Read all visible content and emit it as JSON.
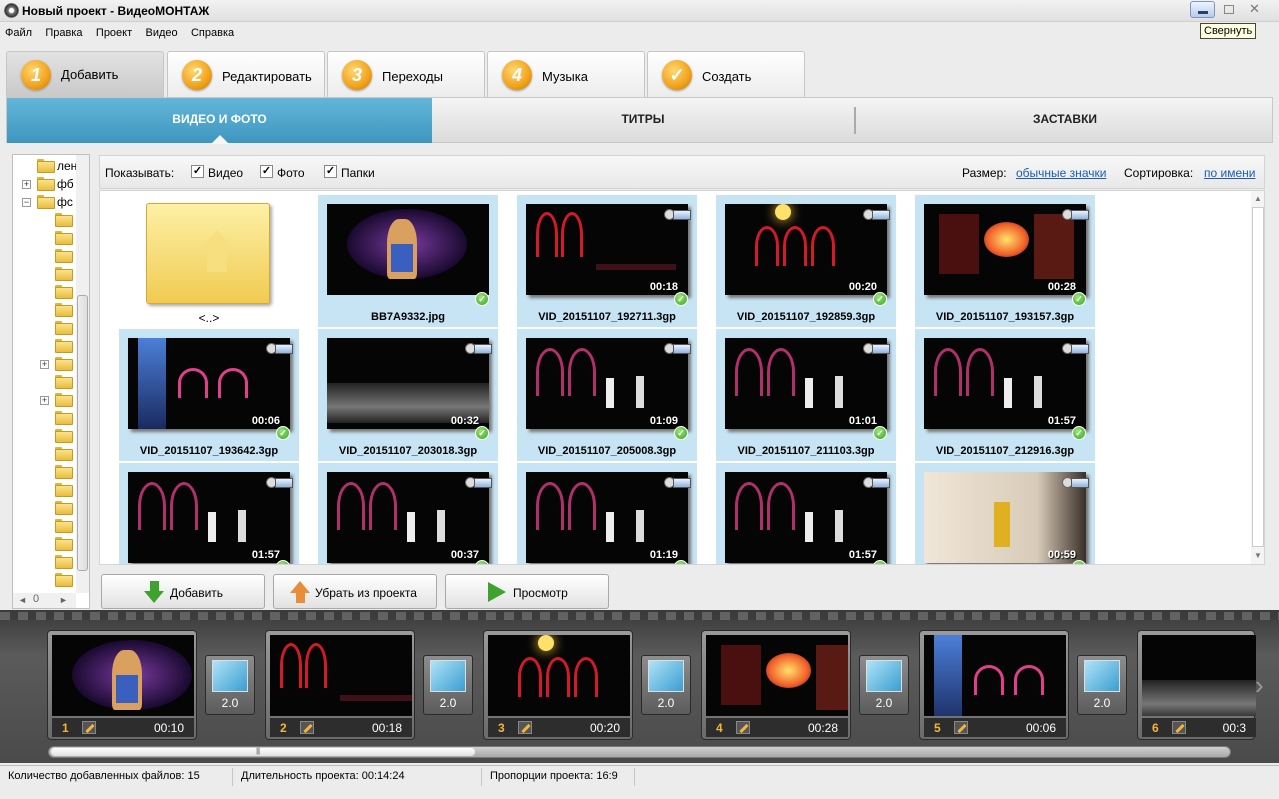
{
  "window": {
    "title": "Новый проект - ВидеоМОНТАЖ",
    "tooltip": "Свернуть",
    "close_glyph": "✕"
  },
  "menu": [
    "Файл",
    "Правка",
    "Проект",
    "Видео",
    "Справка"
  ],
  "steps": [
    {
      "num": "1",
      "label": "Добавить",
      "active": true
    },
    {
      "num": "2",
      "label": "Редактировать"
    },
    {
      "num": "3",
      "label": "Переходы"
    },
    {
      "num": "4",
      "label": "Музыка"
    },
    {
      "num": "✓",
      "label": "Создать"
    }
  ],
  "subtabs": {
    "video": "ВИДЕО И ФОТО",
    "titles": "ТИТРЫ",
    "screens": "ЗАСТАВКИ"
  },
  "tree": {
    "labels": [
      "лен",
      "фб",
      "фс"
    ],
    "expanders": [
      "+",
      "−",
      "+",
      "+"
    ],
    "hscroll_value": "0"
  },
  "filter": {
    "show_label": "Показывать:",
    "video": "Видео",
    "photo": "Фото",
    "folders": "Папки",
    "check": "✓",
    "size_label": "Размер:",
    "size_value": "обычные значки",
    "sort_label": "Сортировка:",
    "sort_value": "по имени"
  },
  "files": [
    {
      "name": "<..>",
      "kind": "up"
    },
    {
      "name": "BB7A9332.jpg",
      "kind": "photo"
    },
    {
      "name": "VID_20151107_192711.3gp",
      "duration": "00:18"
    },
    {
      "name": "VID_20151107_192859.3gp",
      "duration": "00:20"
    },
    {
      "name": "VID_20151107_193157.3gp",
      "duration": "00:28"
    },
    {
      "name": "VID_20151107_193642.3gp",
      "duration": "00:06"
    },
    {
      "name": "VID_20151107_203018.3gp",
      "duration": "00:32"
    },
    {
      "name": "VID_20151107_205008.3gp",
      "duration": "01:09"
    },
    {
      "name": "VID_20151107_211103.3gp",
      "duration": "01:01"
    },
    {
      "name": "VID_20151107_212916.3gp",
      "duration": "01:57"
    },
    {
      "name": "",
      "duration": "01:57"
    },
    {
      "name": "",
      "duration": "00:37"
    },
    {
      "name": "",
      "duration": "01:19"
    },
    {
      "name": "",
      "duration": "01:57"
    },
    {
      "name": "",
      "duration": "00:59"
    }
  ],
  "file_check": "✓",
  "actions": {
    "add": "Добавить",
    "remove": "Убрать из проекта",
    "preview": "Просмотр"
  },
  "filmstrip": {
    "clips": [
      {
        "num": "1",
        "duration": "00:10"
      },
      {
        "num": "2",
        "duration": "00:18"
      },
      {
        "num": "3",
        "duration": "00:20"
      },
      {
        "num": "4",
        "duration": "00:28"
      },
      {
        "num": "5",
        "duration": "00:06"
      },
      {
        "num": "6",
        "duration": "00:3"
      }
    ],
    "transitions": [
      "2.0",
      "2.0",
      "2.0",
      "2.0",
      "2.0"
    ],
    "next_glyph": "›",
    "scroll_grip": "||||"
  },
  "status": {
    "files": "Количество добавленных файлов: 15",
    "duration": "Длительность проекта:  00:14:24",
    "ratio": "Пропорции проекта:  16:9"
  }
}
